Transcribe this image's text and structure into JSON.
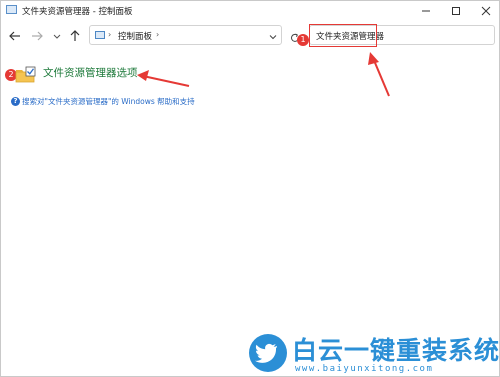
{
  "window": {
    "title": "文件夹资源管理器 - 控制面板"
  },
  "address_bar": {
    "location": "控制面板",
    "separator": "›"
  },
  "search": {
    "query": "文件夹资源管理器"
  },
  "results": {
    "items": [
      {
        "title": "文件资源管理器选项",
        "icon": "folder-options-icon"
      }
    ],
    "help_link": "搜索对\"文件夹资源管理器\"的 Windows 帮助和支持"
  },
  "annotations": {
    "badge_1": "1",
    "badge_2": "2",
    "accent_color": "#e53935"
  },
  "watermark": {
    "title": "白云一键重装系统",
    "url": "www.baiyunxitong.com",
    "color": "#2b8fd6"
  }
}
